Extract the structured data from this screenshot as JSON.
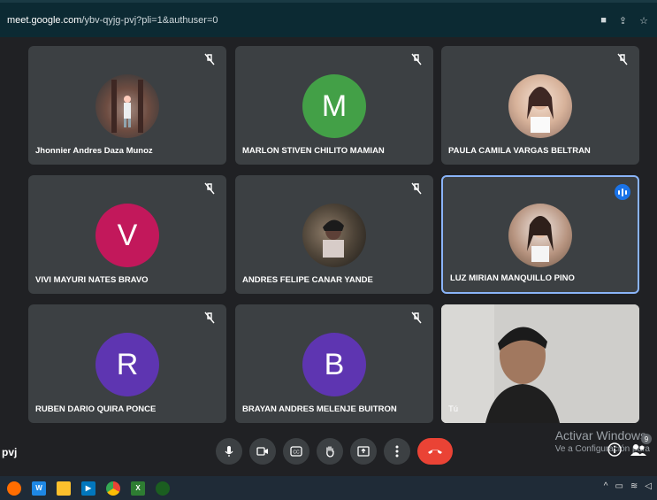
{
  "browser": {
    "url_host": "meet.google.com",
    "url_rest": "/ybv-qyjg-pvj?pli=1&authuser=0"
  },
  "tiles": [
    {
      "name": "Jhonnier Andres Daza Munoz",
      "avatar_type": "photo",
      "avatar_color": "#6d4c41",
      "muted": true
    },
    {
      "name": "MARLON STIVEN CHILITO MAMIAN",
      "avatar_type": "letter",
      "letter": "M",
      "avatar_color": "#43a047",
      "muted": true
    },
    {
      "name": "PAULA CAMILA VARGAS BELTRAN",
      "avatar_type": "photo",
      "avatar_color": "#d7b29a",
      "muted": true
    },
    {
      "name": "VIVI MAYURI NATES BRAVO",
      "avatar_type": "letter",
      "letter": "V",
      "avatar_color": "#c2185b",
      "muted": true
    },
    {
      "name": "ANDRES FELIPE CANAR YANDE",
      "avatar_type": "photo",
      "avatar_color": "#4e4438",
      "muted": true
    },
    {
      "name": "LUZ MIRIAN MANQUILLO PINO",
      "avatar_type": "photo",
      "avatar_color": "#b79480",
      "muted": false,
      "speaking": true
    },
    {
      "name": "RUBEN DARIO QUIRA PONCE",
      "avatar_type": "letter",
      "letter": "R",
      "avatar_color": "#5e35b1",
      "muted": true
    },
    {
      "name": "BRAYAN ANDRES MELENJE BUITRON",
      "avatar_type": "letter",
      "letter": "B",
      "avatar_color": "#5e35b1",
      "muted": true
    }
  ],
  "self_tile": {
    "name": "Tú"
  },
  "meeting_code": "pvj",
  "watermark": {
    "line1": "Activar Windows",
    "line2": "Ve a Configuración para"
  },
  "participants_count": "9",
  "colors": {
    "accent_blue": "#1a73e8",
    "end_call_red": "#ea4335",
    "tile_bg": "#3c4043",
    "page_bg": "#202124"
  }
}
